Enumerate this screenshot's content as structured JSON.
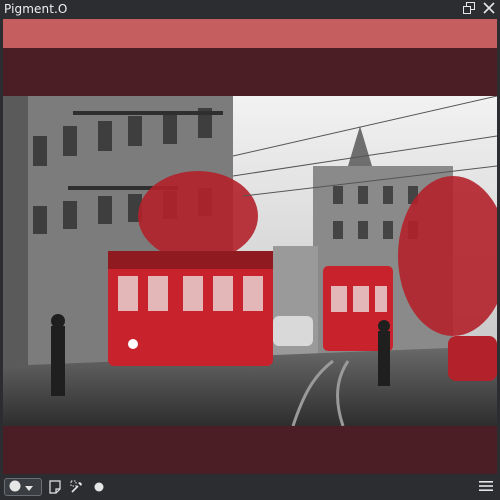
{
  "window": {
    "title": "Pigment.O",
    "icons": [
      "restore-icon",
      "close-icon"
    ]
  },
  "colors": {
    "active_swatch": "#c45e5f",
    "panel_background": "#4a1e24",
    "chrome": "#2b2d30",
    "accent_red": "#c8232c"
  },
  "image": {
    "description_icon": "tram-street-photo"
  },
  "toolbar": {
    "mode_icon": "circle-mode-icon",
    "dropdown_icon": "chevron-down-icon",
    "tools": [
      "document-icon",
      "eyedropper-icon",
      "dot-icon"
    ],
    "menu_icon": "hamburger-menu-icon"
  }
}
